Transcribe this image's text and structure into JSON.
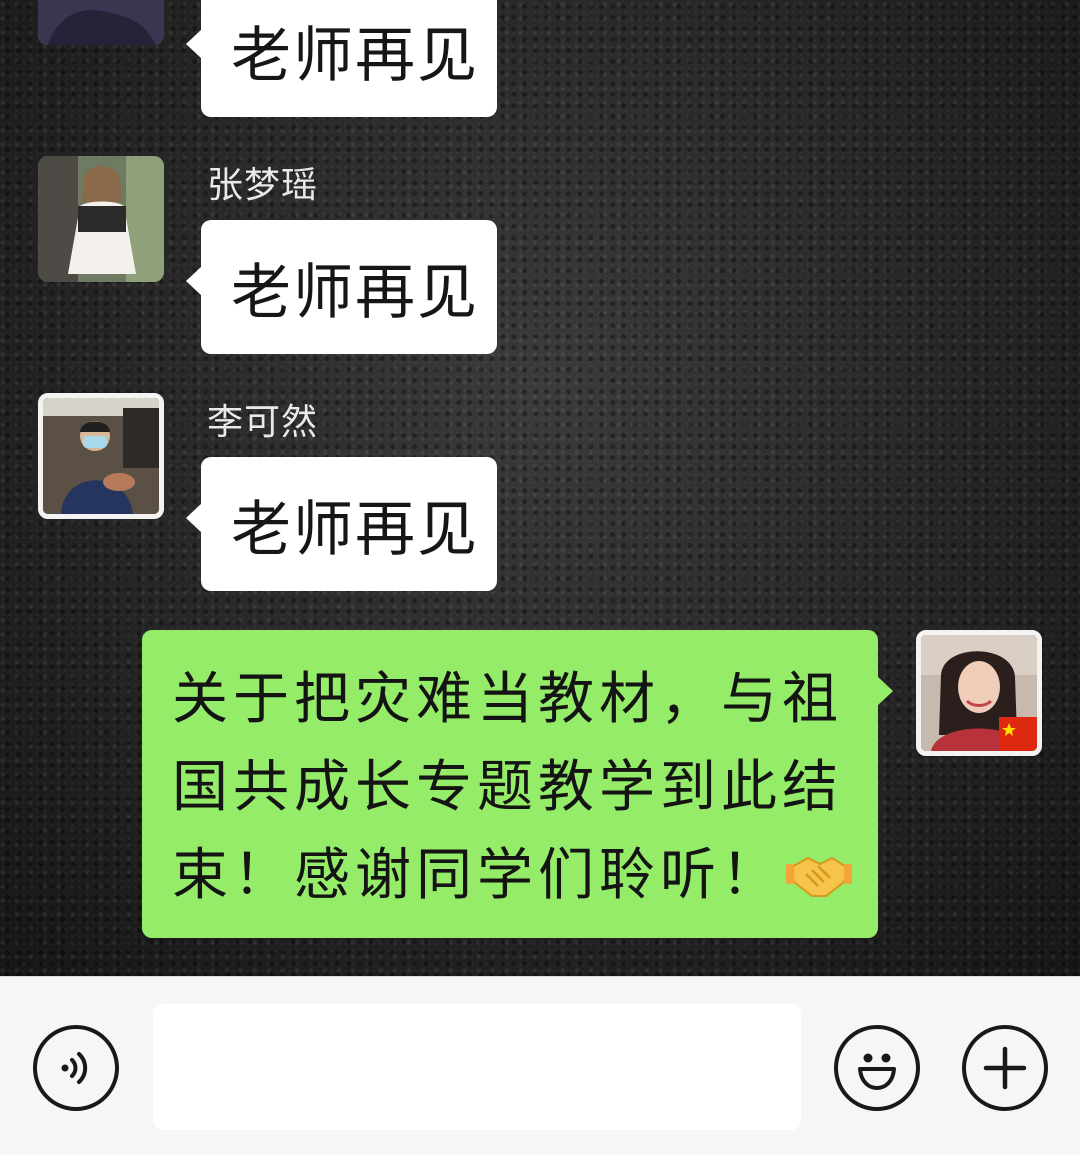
{
  "messages": [
    {
      "sender": "",
      "direction": "incoming",
      "text": "老师再见",
      "avatar_icon": "student-avatar-1"
    },
    {
      "sender": "张梦瑶",
      "direction": "incoming",
      "text": "老师再见",
      "avatar_icon": "student-avatar-2"
    },
    {
      "sender": "李可然",
      "direction": "incoming",
      "text": "老师再见",
      "avatar_icon": "student-avatar-3"
    },
    {
      "sender": "",
      "direction": "outgoing",
      "lines": [
        "关于把灾难当教材，与祖",
        "国共成长专题教学到此结",
        "束！感谢同学们聆听！"
      ],
      "emoji_icon": "handshake-icon",
      "avatar_icon": "teacher-avatar-china-flag"
    }
  ],
  "input_bar": {
    "voice_icon": "voice-icon",
    "input_value": "",
    "emoji_icon": "smiley-icon",
    "plus_icon": "plus-icon"
  },
  "colors": {
    "incoming_bubble": "#ffffff",
    "outgoing_bubble": "#95ec69",
    "sender_name": "#e9e9e9",
    "input_bar_bg": "#f6f6f6"
  }
}
